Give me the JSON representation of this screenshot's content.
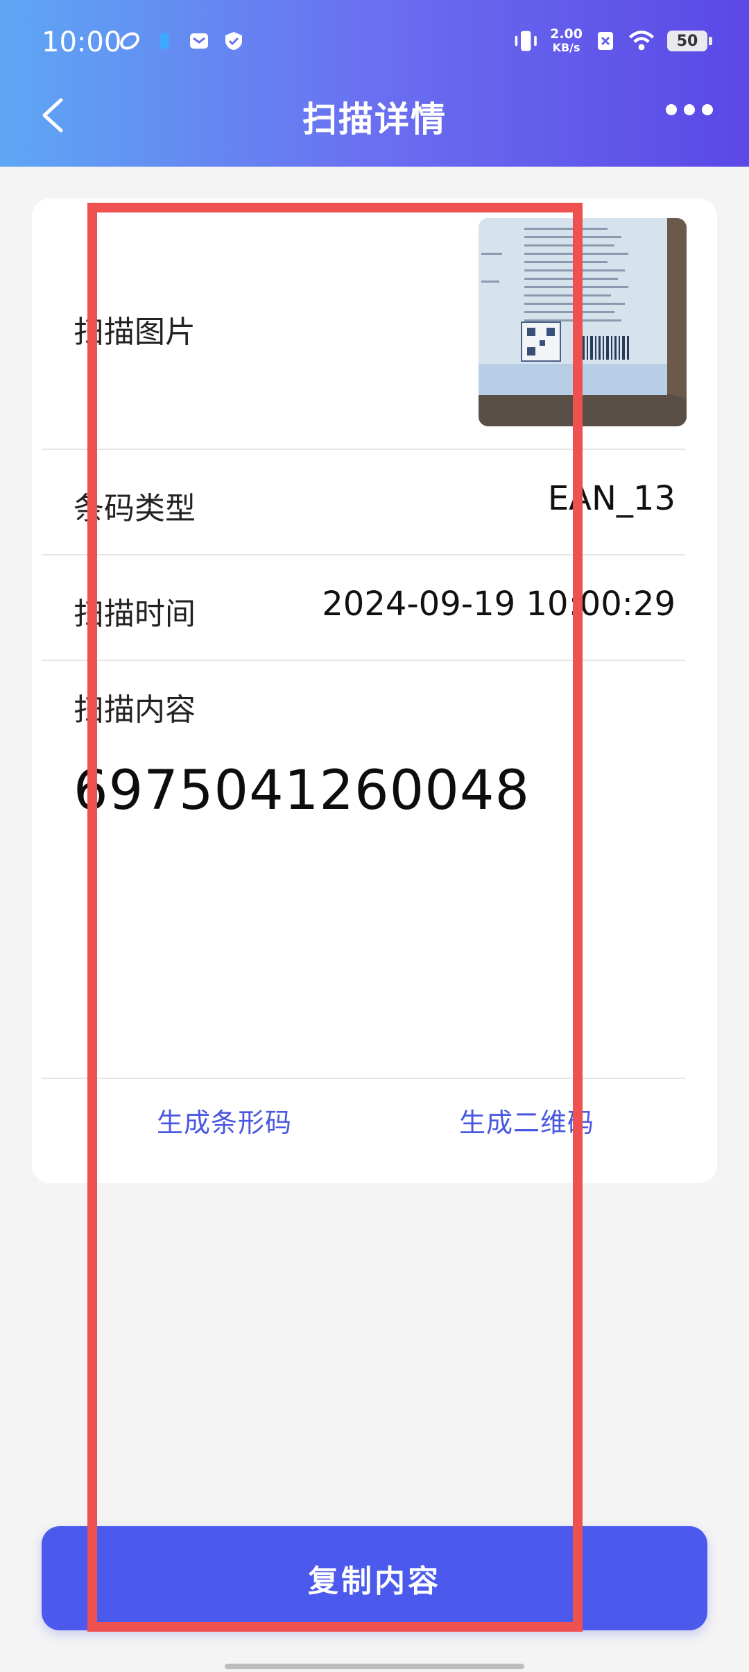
{
  "status_bar": {
    "time": "10:00",
    "netspeed_value": "2.00",
    "netspeed_unit": "KB/s",
    "battery": "50"
  },
  "nav": {
    "title": "扫描详情"
  },
  "detail": {
    "image_label": "扫描图片",
    "barcode_type_label": "条码类型",
    "barcode_type_value": "EAN_13",
    "scan_time_label": "扫描时间",
    "scan_time_value": "2024-09-19 10:00:29",
    "content_label": "扫描内容",
    "content_value": "6975041260048"
  },
  "actions": {
    "gen_barcode": "生成条形码",
    "gen_qrcode": "生成二维码",
    "copy": "复制内容"
  },
  "colors": {
    "accent": "#4b59ec",
    "link": "#4a58e0",
    "highlight": "#ef5050"
  }
}
